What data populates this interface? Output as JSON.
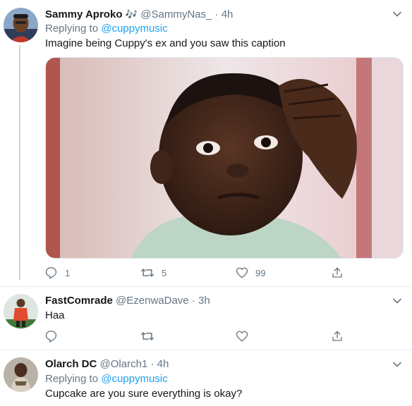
{
  "tweets": [
    {
      "name": "Sammy Aproko",
      "name_emoji": "🎶",
      "handle": "@SammyNas_",
      "dot": "·",
      "time": "4h",
      "replying_prefix": "Replying to",
      "replying_to": "@cuppymusic",
      "text": "Imagine being Cuppy's ex and you saw this caption",
      "has_media": true,
      "actions": {
        "reply": "1",
        "retweet": "5",
        "like": "99"
      }
    },
    {
      "name": "FastComrade",
      "handle": "@EzenwaDave",
      "dot": "·",
      "time": "3h",
      "text": "Haa",
      "actions": {
        "reply": "",
        "retweet": "",
        "like": ""
      }
    },
    {
      "name": "Olarch DC",
      "handle": "@Olarch1",
      "dot": "·",
      "time": "4h",
      "replying_prefix": "Replying to",
      "replying_to": "@cuppymusic",
      "text": "Cupcake are you sure everything is okay?"
    }
  ],
  "icons": {
    "reply": "reply-icon",
    "retweet": "retweet-icon",
    "like": "heart-icon",
    "share": "share-icon",
    "caret": "chevron-down-icon"
  },
  "colors": {
    "accent": "#1da1f2",
    "muted": "#657786",
    "text": "#14171a",
    "border": "#e6ecf0"
  }
}
